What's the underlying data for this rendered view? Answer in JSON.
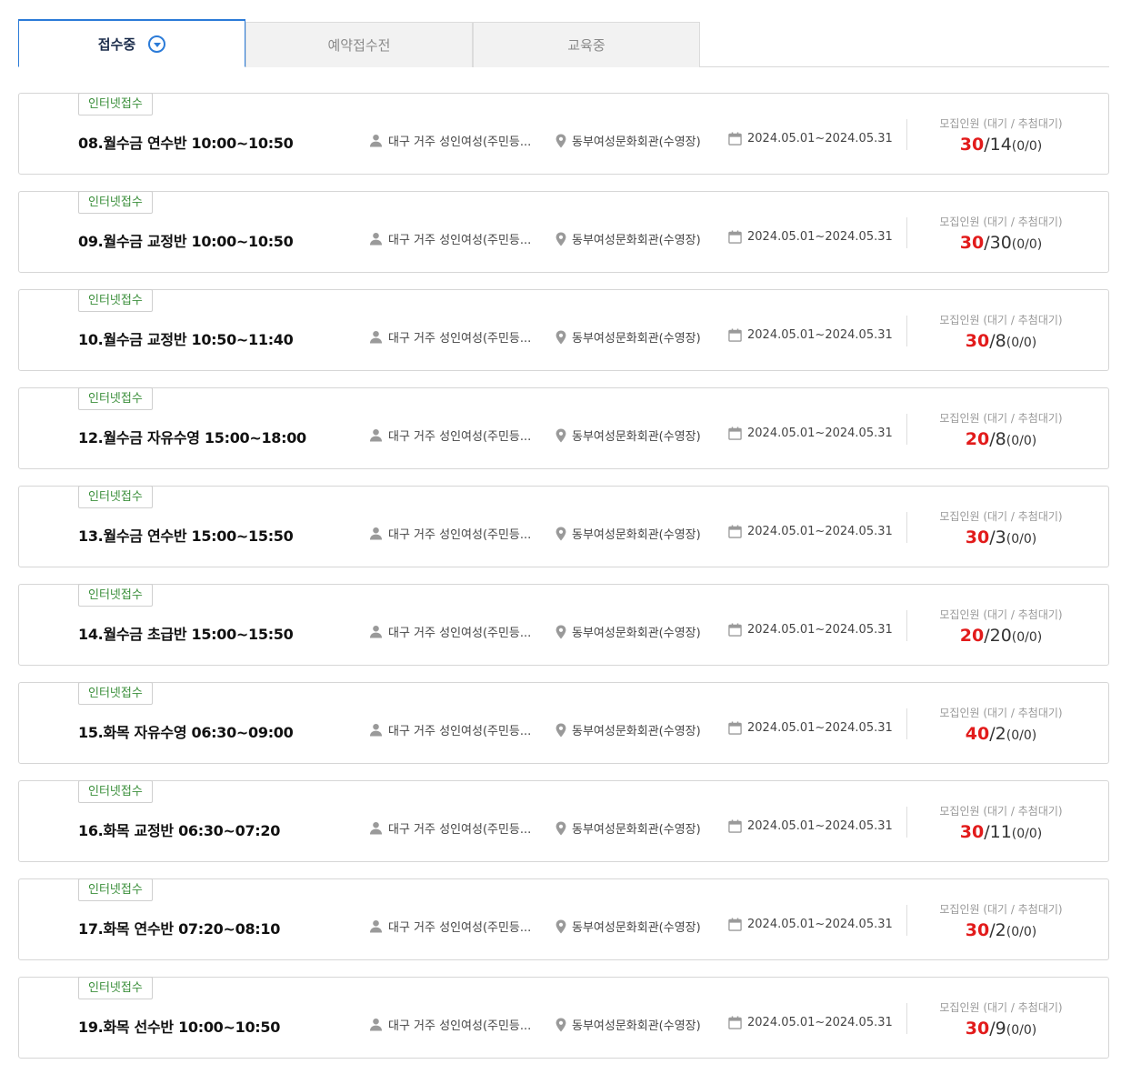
{
  "tabs": [
    {
      "label": "접수중"
    },
    {
      "label": "예약접수전"
    },
    {
      "label": "교육중"
    }
  ],
  "course_labels": {
    "capacity_label": "모집인원 (대기 / 추첨대기)"
  },
  "courses": [
    {
      "badge": "인터넷접수",
      "title": "08.월수금 연수반 10:00~10:50",
      "target": "대구 거주 성인여성(주민등...",
      "place": "동부여성문화회관(수영장)",
      "period": "2024.05.01~2024.05.31",
      "total": "30",
      "applied": "/14",
      "waiting": "(0/0)"
    },
    {
      "badge": "인터넷접수",
      "title": "09.월수금 교정반 10:00~10:50",
      "target": "대구 거주 성인여성(주민등...",
      "place": "동부여성문화회관(수영장)",
      "period": "2024.05.01~2024.05.31",
      "total": "30",
      "applied": "/30",
      "waiting": "(0/0)"
    },
    {
      "badge": "인터넷접수",
      "title": "10.월수금 교정반 10:50~11:40",
      "target": "대구 거주 성인여성(주민등...",
      "place": "동부여성문화회관(수영장)",
      "period": "2024.05.01~2024.05.31",
      "total": "30",
      "applied": "/8",
      "waiting": "(0/0)"
    },
    {
      "badge": "인터넷접수",
      "title": "12.월수금 자유수영 15:00~18:00",
      "target": "대구 거주 성인여성(주민등...",
      "place": "동부여성문화회관(수영장)",
      "period": "2024.05.01~2024.05.31",
      "total": "20",
      "applied": "/8",
      "waiting": "(0/0)"
    },
    {
      "badge": "인터넷접수",
      "title": "13.월수금 연수반 15:00~15:50",
      "target": "대구 거주 성인여성(주민등...",
      "place": "동부여성문화회관(수영장)",
      "period": "2024.05.01~2024.05.31",
      "total": "30",
      "applied": "/3",
      "waiting": "(0/0)"
    },
    {
      "badge": "인터넷접수",
      "title": "14.월수금 초급반 15:00~15:50",
      "target": "대구 거주 성인여성(주민등...",
      "place": "동부여성문화회관(수영장)",
      "period": "2024.05.01~2024.05.31",
      "total": "20",
      "applied": "/20",
      "waiting": "(0/0)"
    },
    {
      "badge": "인터넷접수",
      "title": "15.화목 자유수영 06:30~09:00",
      "target": "대구 거주 성인여성(주민등...",
      "place": "동부여성문화회관(수영장)",
      "period": "2024.05.01~2024.05.31",
      "total": "40",
      "applied": "/2",
      "waiting": "(0/0)"
    },
    {
      "badge": "인터넷접수",
      "title": "16.화목 교정반 06:30~07:20",
      "target": "대구 거주 성인여성(주민등...",
      "place": "동부여성문화회관(수영장)",
      "period": "2024.05.01~2024.05.31",
      "total": "30",
      "applied": "/11",
      "waiting": "(0/0)"
    },
    {
      "badge": "인터넷접수",
      "title": "17.화목 연수반 07:20~08:10",
      "target": "대구 거주 성인여성(주민등...",
      "place": "동부여성문화회관(수영장)",
      "period": "2024.05.01~2024.05.31",
      "total": "30",
      "applied": "/2",
      "waiting": "(0/0)"
    },
    {
      "badge": "인터넷접수",
      "title": "19.화목 선수반 10:00~10:50",
      "target": "대구 거주 성인여성(주민등...",
      "place": "동부여성문화회관(수영장)",
      "period": "2024.05.01~2024.05.31",
      "total": "30",
      "applied": "/9",
      "waiting": "(0/0)"
    }
  ],
  "icons": {
    "target": "person-icon",
    "place": "location-pin-icon",
    "period": "calendar-icon",
    "tab_caret": "chevron-down-circle-icon"
  },
  "colors": {
    "accent": "#2b7bd8",
    "badge_text": "#3b8f3b",
    "capacity_total": "#e21b1b"
  }
}
